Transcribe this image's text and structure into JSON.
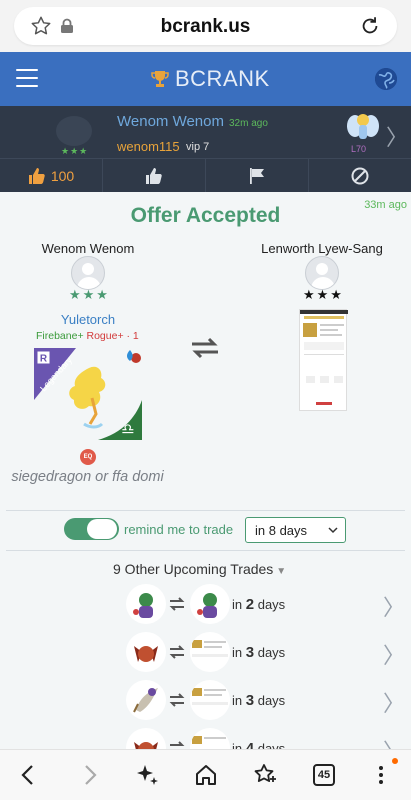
{
  "browser": {
    "domain": "bcrank.us",
    "tab_count": "45"
  },
  "site": {
    "brand": "BCRANK",
    "colors": {
      "header": "#3a6fbf",
      "panel": "#2f3948",
      "accent_green": "#4a9a72",
      "link_blue": "#6fa8dc",
      "orange": "#e8a33a"
    }
  },
  "userbar": {
    "name": "Wenom Wenom",
    "time_ago": "32m ago",
    "handle": "wenom115",
    "vip": "vip 7",
    "stars": "★★★",
    "level": "L70",
    "chevron": "〉"
  },
  "actions": {
    "likes": "100"
  },
  "offer": {
    "time_ago": "33m ago",
    "title": "Offer Accepted",
    "left": {
      "name": "Wenom Wenom",
      "stars": "★★★",
      "monster": "Yuletorch",
      "element1": "Firebane+",
      "element2": "Rogue+",
      "element_sep": "· 1",
      "rarity": "Legendary",
      "badge": "R",
      "eq": "EQ",
      "note": "siegedragon or ffa domi"
    },
    "right": {
      "name": "Lenworth Lyew-Sang",
      "stars": "★★★"
    }
  },
  "remind": {
    "label": "remind me to trade",
    "selected": "in 8 days",
    "enabled": true
  },
  "upcoming": {
    "title": "9 Other Upcoming Trades",
    "rows": [
      {
        "prefix": "in",
        "days": "2",
        "suffix": "days"
      },
      {
        "prefix": "in",
        "days": "3",
        "suffix": "days"
      },
      {
        "prefix": "in",
        "days": "3",
        "suffix": "days"
      },
      {
        "prefix": "in",
        "days": "4",
        "suffix": "days"
      }
    ]
  }
}
